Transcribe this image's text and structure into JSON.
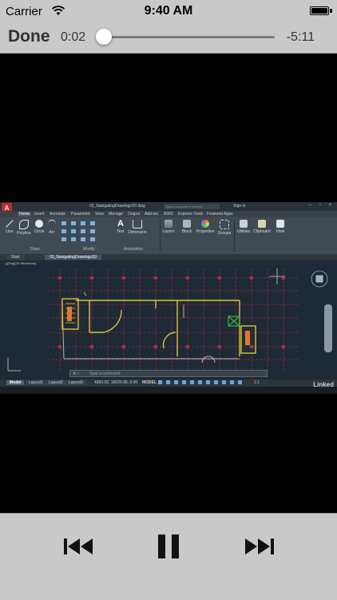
{
  "status_bar": {
    "carrier": "Carrier",
    "time": "9:40 AM",
    "wifi_icon": "wifi-icon",
    "battery_icon": "battery-icon"
  },
  "player": {
    "done_label": "Done",
    "elapsed": "0:02",
    "remaining": "-5:11",
    "progress_fraction": 0.01,
    "controls": {
      "previous_icon": "skip-back-icon",
      "pause_icon": "pause-icon",
      "next_icon": "skip-forward-icon"
    }
  },
  "video": {
    "title_bar": {
      "filename": "03_NavigatingDrawings3D.dwg",
      "search_placeholder": "Type a keyword or phrase",
      "sign_in": "Sign In"
    },
    "ribbon_tabs": [
      "Home",
      "Insert",
      "Annotate",
      "Parametric",
      "View",
      "Manage",
      "Output",
      "Add-ins",
      "A360",
      "Express Tools",
      "Featured Apps"
    ],
    "draw_tools": [
      "Line",
      "Polyline",
      "Circle",
      "Arc"
    ],
    "modify_tools_label": "Modify",
    "draw_panel_label": "Draw",
    "annotation_tools": [
      "Text",
      "Dimension"
    ],
    "annotation_panel_label": "Annotation",
    "other_tools": [
      "Layers",
      "Block",
      "Properties",
      "Groups",
      "Utilities",
      "Clipboard",
      "View"
    ],
    "file_tabs": [
      "Start",
      "03_NavigatingDrawings3D"
    ],
    "viewport_label": "[-][Top][2D Wireframe]",
    "command_placeholder": "Type a command",
    "layout_tabs": [
      "Model",
      "Layout1",
      "Layout2",
      "Layout3"
    ],
    "coordinates": "4360.02, 16020.06, 0.00",
    "space_label": "MODEL",
    "zoom_value": "1:1",
    "watermark": "Linked"
  }
}
